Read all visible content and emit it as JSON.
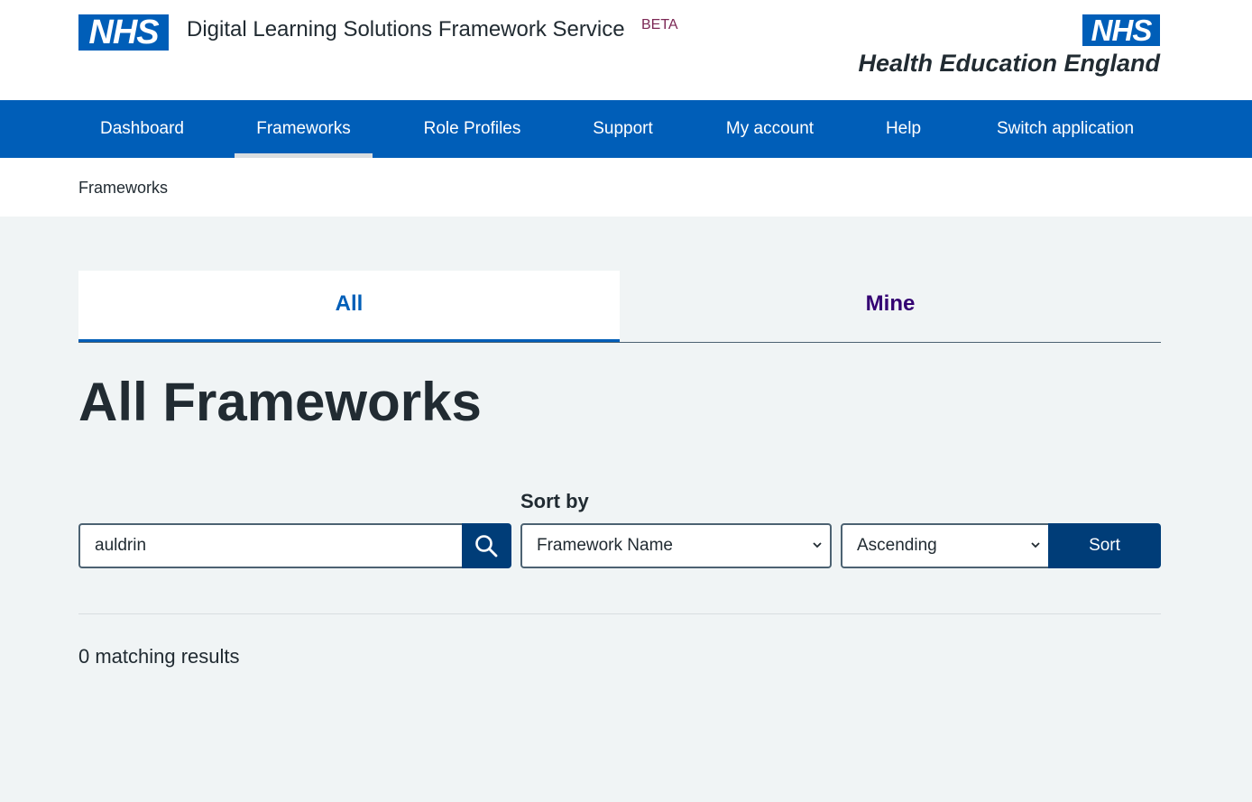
{
  "header": {
    "logo_text": "NHS",
    "service_name": "Digital Learning Solutions Framework Service",
    "beta_tag": "BETA",
    "partner_logo_text": "NHS",
    "partner_name": "Health Education England"
  },
  "nav": {
    "items": [
      {
        "label": "Dashboard"
      },
      {
        "label": "Frameworks"
      },
      {
        "label": "Role Profiles"
      },
      {
        "label": "Support"
      },
      {
        "label": "My account"
      },
      {
        "label": "Help"
      },
      {
        "label": "Switch application"
      }
    ],
    "active": "Frameworks"
  },
  "breadcrumb": {
    "label": "Frameworks"
  },
  "tabs": [
    {
      "label": "All"
    },
    {
      "label": "Mine"
    }
  ],
  "page_title": "All Frameworks",
  "search": {
    "value": "auldrin",
    "icon": "search-icon"
  },
  "sort": {
    "label": "Sort by",
    "field_value": "Framework Name",
    "direction_value": "Ascending",
    "button_label": "Sort"
  },
  "results_text": "0 matching results",
  "colors": {
    "nhs_blue": "#005eb8",
    "dark_blue": "#003d78",
    "background": "#f0f4f5",
    "text": "#212b32",
    "mine_purple": "#330072",
    "beta_plum": "#7c2855"
  }
}
